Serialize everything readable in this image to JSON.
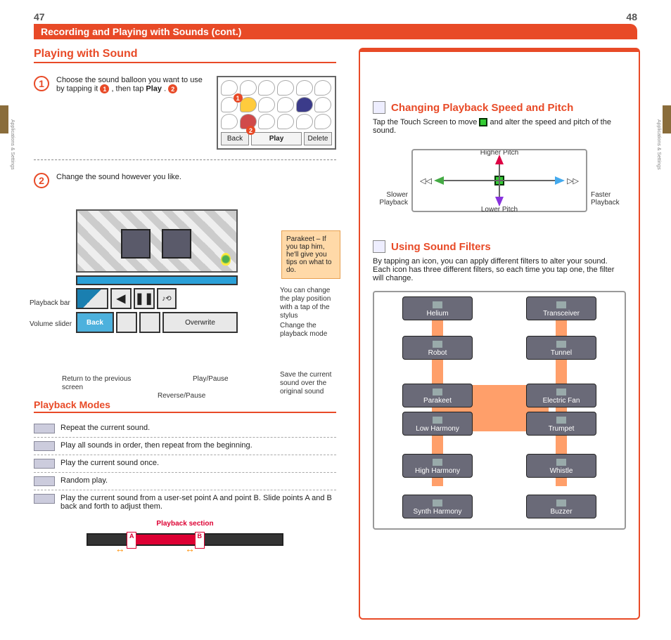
{
  "pageLeft": "47",
  "pageRight": "48",
  "sideLabel": "Applications & Settings",
  "header": "Recording and Playing with Sounds (cont.)",
  "section1": "Playing with Sound",
  "step1_text_a": "Choose the sound balloon you want to use by tapping it ",
  "step1_text_b": " , then tap ",
  "step1_play": "Play",
  "step1_text_c": ". ",
  "shot1": {
    "back": "Back",
    "play": "Play",
    "delete": "Delete"
  },
  "step2_text": "Change the sound however you like.",
  "parakeet_tip": "Parakeet – If you tap him, he'll give you tips on what to do.",
  "annot": {
    "playback_bar": "Playback bar",
    "volume": "Volume slider",
    "return": "Return to the previous screen",
    "reverse": "Reverse/Pause",
    "playpause": "Play/Pause",
    "playpos": "You can change the play position with a tap of the stylus",
    "mode": "Change the playback mode",
    "save": "Save the current sound over the original sound"
  },
  "shot2": {
    "back": "Back",
    "overwrite": "Overwrite",
    "rev": "◀",
    "pause": "❚❚"
  },
  "modes_heading": "Playback Modes",
  "modes": [
    "Repeat the current sound.",
    "Play all sounds in order, then repeat from the beginning.",
    "Play the current sound once.",
    "Random play.",
    "Play the current sound from a user-set point A and point B. Slide points A and B back and forth to adjust them."
  ],
  "playback_section": "Playback section",
  "markerA": "A",
  "markerB": "B",
  "pitch_heading": "Changing Playback Speed and Pitch",
  "pitch_text_a": "Tap the Touch Screen to move ",
  "pitch_text_b": " and alter the speed and pitch of the sound.",
  "axis": {
    "up": "Higher Pitch",
    "down": "Lower Pitch",
    "left": "Slower Playback",
    "right": "Faster Playback"
  },
  "filters_heading": "Using Sound Filters",
  "filters_text": "By tapping an icon, you can apply different filters to alter your sound. Each icon has three different filters, so each time you tap one, the filter will change.",
  "filters": {
    "helium": "Helium",
    "robot": "Robot",
    "parakeet": "Parakeet",
    "lowh": "Low Harmony",
    "highh": "High Harmony",
    "synth": "Synth Harmony",
    "trans": "Transceiver",
    "tunnel": "Tunnel",
    "fan": "Electric Fan",
    "trumpet": "Trumpet",
    "whistle": "Whistle",
    "buzzer": "Buzzer"
  }
}
